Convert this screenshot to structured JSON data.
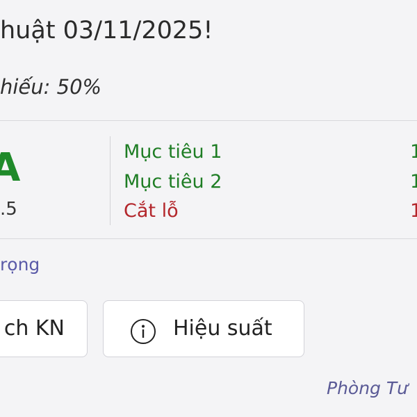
{
  "header": {
    "title": "huật 03/11/2025!",
    "ratio_text": "hiếu: 50%"
  },
  "summary": {
    "rating": "A",
    "score": ".5"
  },
  "targets": [
    {
      "label": "Mục tiêu 1",
      "value": "1",
      "color": "#1e7d24"
    },
    {
      "label": "Mục tiêu 2",
      "value": "1",
      "color": "#1e7d24"
    },
    {
      "label": "Cắt lỗ",
      "value": "1",
      "color": "#b3262b"
    }
  ],
  "link_text": "rọng",
  "buttons": {
    "history_label": "ch KN",
    "performance_label": "Hiệu suất"
  },
  "icons": {
    "performance": "info-circle-icon"
  },
  "footer": "Phòng Tư",
  "colors": {
    "rating_green": "#1f8a2a",
    "link": "#5a5aa8"
  }
}
